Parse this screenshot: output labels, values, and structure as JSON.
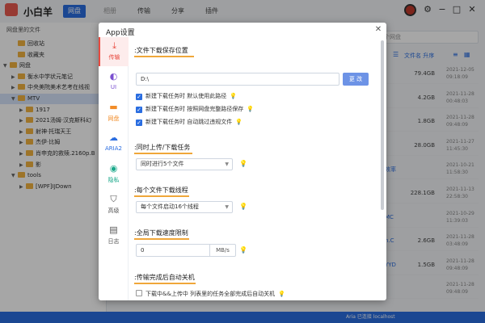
{
  "app": {
    "title": "小白羊"
  },
  "nav_tabs": [
    "网盘",
    "相册",
    "传输",
    "分享",
    "插件"
  ],
  "sidebar": {
    "header": "网盘里的文件",
    "tree": [
      {
        "label": "回收站",
        "level": 1,
        "arrow": ""
      },
      {
        "label": "收藏夹",
        "level": 1,
        "arrow": ""
      },
      {
        "label": "网盘",
        "level": 0,
        "arrow": "▼"
      },
      {
        "label": "衡水中学状元笔记",
        "level": 1,
        "arrow": "▶"
      },
      {
        "label": "中央美院美术艺考在线视",
        "level": 1,
        "arrow": "▶"
      },
      {
        "label": "MTV",
        "level": 1,
        "arrow": "▼",
        "selected": true
      },
      {
        "label": "1917",
        "level": 2,
        "arrow": "▶"
      },
      {
        "label": "2021汤姆·汉克斯科幻",
        "level": 2,
        "arrow": "▶"
      },
      {
        "label": "射神·托瑞天王",
        "level": 2,
        "arrow": "▶"
      },
      {
        "label": "杰伊·比姆",
        "level": 2,
        "arrow": "▶"
      },
      {
        "label": "肖申克的救赎.2160p.B",
        "level": 2,
        "arrow": "▶"
      },
      {
        "label": "影",
        "level": 2,
        "arrow": "▶"
      },
      {
        "label": "tools",
        "level": 1,
        "arrow": "▼"
      },
      {
        "label": "[WPF]IJDown",
        "level": 2,
        "arrow": "▶"
      }
    ]
  },
  "file_list": {
    "search_placeholder": "个网盘",
    "sort_label": "文件名 升序",
    "rows": [
      {
        "frag": "",
        "size": "79.4GB",
        "date": "2021-12-05 09:18:09"
      },
      {
        "frag": "",
        "size": "4.2GB",
        "date": "2021-11-28 00:48:03"
      },
      {
        "frag": "",
        "size": "1.8GB",
        "date": "2021-11-28 09:48:09"
      },
      {
        "frag": "",
        "size": "28.0GB",
        "date": "2021-11-27 11:45:30"
      },
      {
        "frag": "效率",
        "size": "",
        "date": "2021-10-21 11:58:30"
      },
      {
        "frag": "",
        "size": "228.1GB",
        "date": "2021-11-13 22:58:30"
      },
      {
        "frag": "MC",
        "size": "",
        "date": "2021-10-29 11:39:03"
      },
      {
        "frag": "n.C",
        "size": "2.6GB",
        "date": "2021-11-28 03:48:09"
      },
      {
        "frag": "YYD",
        "size": "1.5GB",
        "date": "2021-11-28 09:48:09"
      },
      {
        "frag": "",
        "size": "",
        "date": "2021-11-28 09:48:09"
      }
    ]
  },
  "statusbar": {
    "text": "Aria 已连接 localhost"
  },
  "modal": {
    "title": "App设置",
    "nav": [
      {
        "label": "传输",
        "icon": "download-icon",
        "glyph": "⤓",
        "active": true
      },
      {
        "label": "UI",
        "icon": "ui-icon",
        "glyph": "◐",
        "active": false
      },
      {
        "label": "网盘",
        "icon": "folder-icon",
        "glyph": "▬",
        "active": false
      },
      {
        "label": "ARIA2",
        "icon": "cloud-icon",
        "glyph": "☁",
        "active": false
      },
      {
        "label": "隐私",
        "icon": "eye-icon",
        "glyph": "◉",
        "active": false
      },
      {
        "label": "高级",
        "icon": "shield-icon",
        "glyph": "⛉",
        "active": false
      },
      {
        "label": "日志",
        "icon": "log-icon",
        "glyph": "▤",
        "active": false
      }
    ],
    "sections": {
      "download_path": {
        "title": ":文件下载保存位置",
        "path": "D:\\",
        "change_label": "更 改",
        "options": [
          {
            "label": "新建下载任务时 默认使用此路径",
            "checked": true
          },
          {
            "label": "新建下载任务时 按照网盘完整路径保存",
            "checked": true
          },
          {
            "label": "新建下载任务时 自动跳过违规文件",
            "checked": true
          }
        ]
      },
      "concurrent": {
        "title": ":同时上传/下载任务",
        "value": "同时进行5个文件"
      },
      "threads": {
        "title": ":每个文件下载线程",
        "value": "每个文件启动16个线程"
      },
      "speed": {
        "title": ":全局下载速度限制",
        "value": "0",
        "unit": "MB/s"
      },
      "shutdown": {
        "title": ":传输完成后自动关机",
        "option": {
          "label": "下载中&&上传中 列表里的任务全部完成后自动关机",
          "checked": false
        }
      }
    }
  },
  "colors": {
    "accent": "#2a6de0",
    "nav_active": "#e84a3f",
    "underline": "#f0a73a",
    "bulb": "#f2c21e"
  }
}
